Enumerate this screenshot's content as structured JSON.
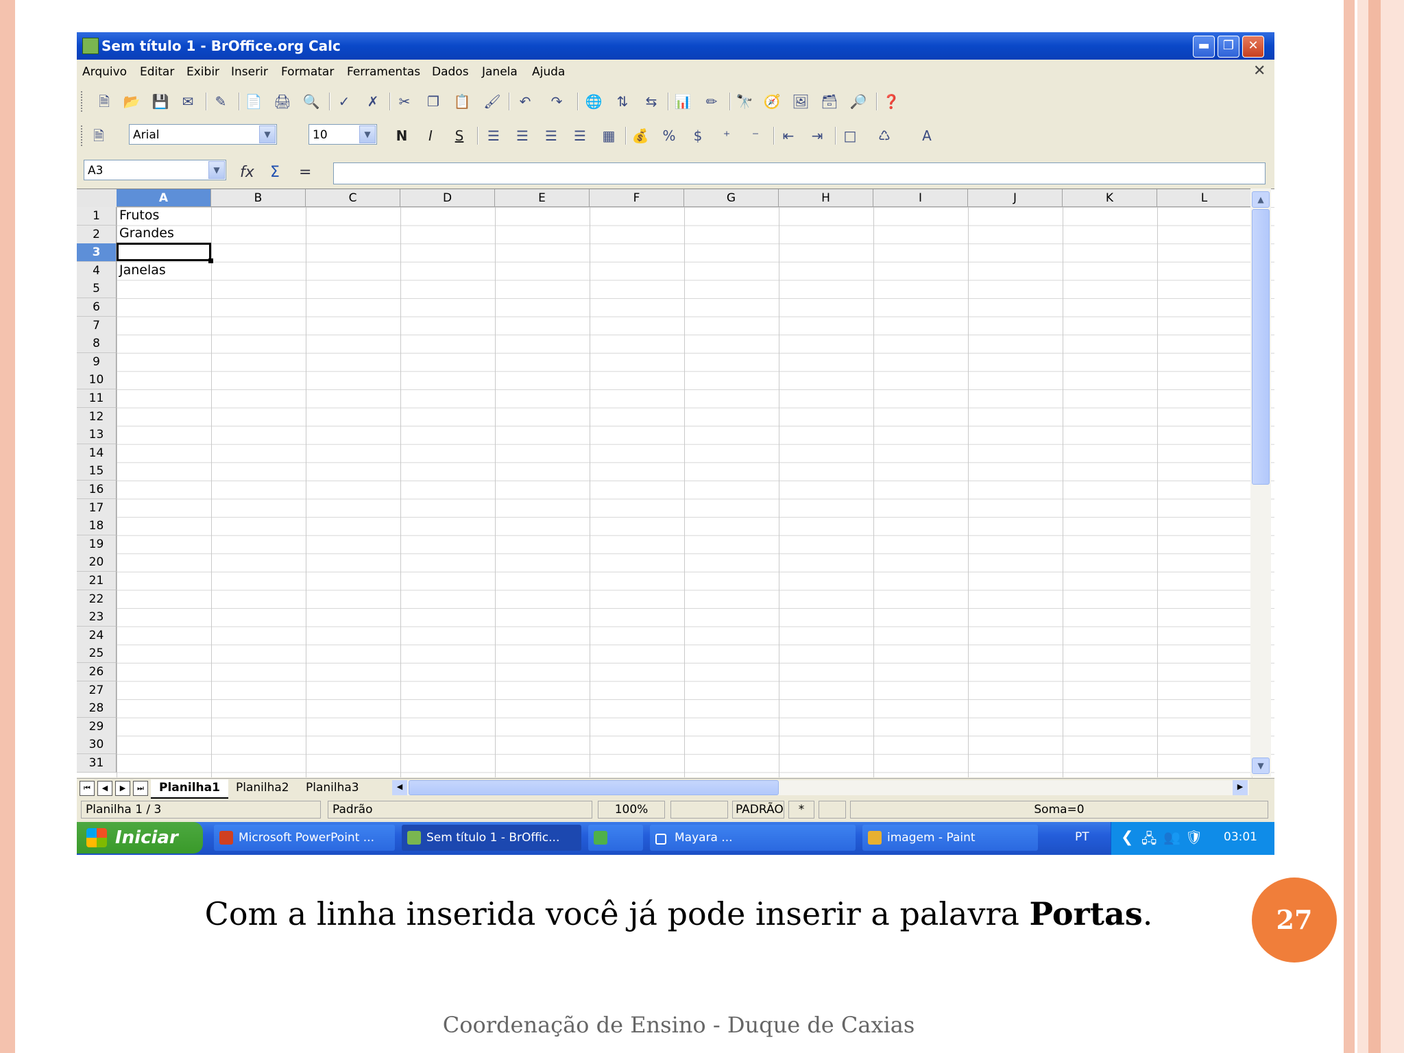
{
  "window": {
    "title": "Sem título 1 - BrOffice.org Calc"
  },
  "menu": [
    "Arquivo",
    "Editar",
    "Exibir",
    "Inserir",
    "Formatar",
    "Ferramentas",
    "Dados",
    "Janela",
    "Ajuda"
  ],
  "formatting": {
    "font_name": "Arial",
    "font_size": "10",
    "bold_label": "N",
    "italic_label": "I",
    "underline_label": "S"
  },
  "name_box": "A3",
  "formula_symbols": {
    "function": "fx",
    "sum": "Σ",
    "equals": "="
  },
  "columns": [
    "A",
    "B",
    "C",
    "D",
    "E",
    "F",
    "G",
    "H",
    "I",
    "J",
    "K",
    "L"
  ],
  "active_column": "A",
  "active_row": "3",
  "rows": [
    "1",
    "2",
    "3",
    "4",
    "5",
    "6",
    "7",
    "8",
    "9",
    "10",
    "11",
    "12",
    "13",
    "14",
    "15",
    "16",
    "17",
    "18",
    "19",
    "20",
    "21",
    "22",
    "23",
    "24",
    "25",
    "26",
    "27",
    "28",
    "29",
    "30",
    "31"
  ],
  "cells": {
    "A1": "Frutos",
    "A2": "Grandes",
    "A4": "Janelas"
  },
  "sheets": [
    "Planilha1",
    "Planilha2",
    "Planilha3"
  ],
  "active_sheet": "Planilha1",
  "status": {
    "sheet_pos": "Planilha 1 / 3",
    "style": "Padrão",
    "zoom": "100%",
    "mode": "PADRÃO",
    "modified": "*",
    "sum": "Soma=0"
  },
  "taskbar": {
    "start_label": "Iniciar",
    "tasks": [
      "Microsoft PowerPoint ...",
      "Sem título 1 - BrOffic...",
      "Mayara    ...",
      "imagem - Paint"
    ],
    "language": "PT",
    "clock": "03:01"
  },
  "slide": {
    "caption_prefix": "Com a linha inserida você já pode inserir a palavra ",
    "caption_bold": "Portas",
    "caption_suffix": ".",
    "page_number": "27",
    "footer": "Coordenação de Ensino - Duque de Caxias"
  }
}
